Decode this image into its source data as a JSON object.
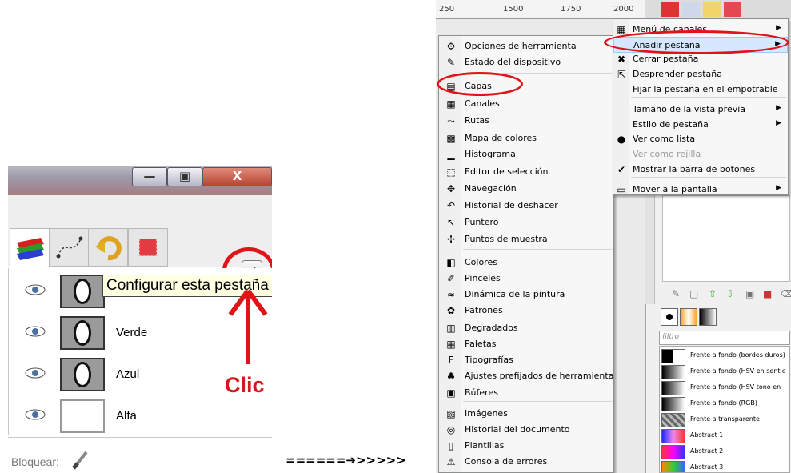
{
  "left_panel": {
    "window_buttons": {
      "minimize": "—",
      "maximize": "▣",
      "close": "X"
    },
    "tab_config_tooltip": "Configurar esta pestaña",
    "channels": [
      {
        "name": ""
      },
      {
        "name": "Verde"
      },
      {
        "name": "Azul"
      },
      {
        "name": "Alfa"
      }
    ],
    "click_label": "Clic",
    "lock_label": "Bloquear:"
  },
  "between_arrow": "======➔>>>>>",
  "ruler": {
    "labels": [
      "250",
      "1500",
      "1750",
      "2000"
    ]
  },
  "tab_menu": {
    "items": [
      {
        "label": "Opciones de herramienta",
        "icon": "tool-options-icon",
        "glyph": "⚙"
      },
      {
        "label": "Estado del dispositivo",
        "icon": "device-status-icon",
        "glyph": "✎"
      },
      {
        "label": "Capas",
        "icon": "layers-icon",
        "glyph": "▤"
      },
      {
        "label": "Canales",
        "icon": "channels-icon",
        "glyph": "▦"
      },
      {
        "label": "Rutas",
        "icon": "paths-icon",
        "glyph": "⤳"
      },
      {
        "label": "Mapa de colores",
        "icon": "colormap-icon",
        "glyph": "▩"
      },
      {
        "label": "Histograma",
        "icon": "histogram-icon",
        "glyph": "▁"
      },
      {
        "label": "Editor de selección",
        "icon": "selection-editor-icon",
        "glyph": "⬚"
      },
      {
        "label": "Navegación",
        "icon": "navigation-icon",
        "glyph": "✥"
      },
      {
        "label": "Historial de deshacer",
        "icon": "undo-history-icon",
        "glyph": "↶"
      },
      {
        "label": "Puntero",
        "icon": "pointer-icon",
        "glyph": "↖"
      },
      {
        "label": "Puntos de muestra",
        "icon": "sample-points-icon",
        "glyph": "✢"
      },
      {
        "label": "Colores",
        "icon": "colors-icon",
        "glyph": "◧"
      },
      {
        "label": "Pinceles",
        "icon": "brushes-icon",
        "glyph": "✐"
      },
      {
        "label": "Dinámica de la pintura",
        "icon": "paint-dynamics-icon",
        "glyph": "≈"
      },
      {
        "label": "Patrones",
        "icon": "patterns-icon",
        "glyph": "✿"
      },
      {
        "label": "Degradados",
        "icon": "gradients-icon",
        "glyph": "▥"
      },
      {
        "label": "Paletas",
        "icon": "palettes-icon",
        "glyph": "▦"
      },
      {
        "label": "Tipografías",
        "icon": "fonts-icon",
        "glyph": "F"
      },
      {
        "label": "Ajustes prefijados de herramienta",
        "icon": "tool-presets-icon",
        "glyph": "♣"
      },
      {
        "label": "Búferes",
        "icon": "buffers-icon",
        "glyph": "▣"
      },
      {
        "label": "Imágenes",
        "icon": "images-icon",
        "glyph": "▧"
      },
      {
        "label": "Historial del documento",
        "icon": "document-history-icon",
        "glyph": "◎"
      },
      {
        "label": "Plantillas",
        "icon": "templates-icon",
        "glyph": "▯"
      },
      {
        "label": "Consola de errores",
        "icon": "error-console-icon",
        "glyph": "⚠"
      }
    ]
  },
  "config_menu": {
    "items": [
      {
        "label": "Menú de canales",
        "icon": "channels-menu-icon",
        "glyph": "▦",
        "submenu": true
      },
      {
        "label": "Añadir pestaña",
        "icon": "",
        "glyph": "",
        "submenu": true,
        "highlighted": true
      },
      {
        "label": "Cerrar pestaña",
        "icon": "close-tab-icon",
        "glyph": "✖",
        "submenu": false
      },
      {
        "label": "Desprender pestaña",
        "icon": "detach-tab-icon",
        "glyph": "⇱",
        "submenu": false
      },
      {
        "label": "Fijar la pestaña en el empotrable",
        "icon": "",
        "glyph": "",
        "submenu": false
      },
      {
        "label": "Tamaño de la vista previa",
        "icon": "",
        "glyph": "",
        "submenu": true
      },
      {
        "label": "Estilo de pestaña",
        "icon": "",
        "glyph": "",
        "submenu": true
      },
      {
        "label": "Ver como lista",
        "icon": "radio-bullet-icon",
        "glyph": "●",
        "submenu": false
      },
      {
        "label": "Ver como rejilla",
        "icon": "",
        "glyph": "",
        "submenu": false,
        "disabled": true
      },
      {
        "label": "Mostrar la barra de botones",
        "icon": "checkmark-icon",
        "glyph": "✔",
        "submenu": false
      },
      {
        "label": "Mover a la pantalla",
        "icon": "move-screen-icon",
        "glyph": "▭",
        "submenu": true
      }
    ]
  },
  "gradients": {
    "filter_placeholder": "filtro",
    "items": [
      {
        "label": "Frente a fondo (bordes duros)"
      },
      {
        "label": "Frente a fondo (HSV en sentic"
      },
      {
        "label": "Frente a fondo (HSV tono en"
      },
      {
        "label": "Frente a fondo (RGB)"
      },
      {
        "label": "Frente a transparente"
      },
      {
        "label": "Abstract 1"
      },
      {
        "label": "Abstract 2"
      },
      {
        "label": "Abstract 3"
      }
    ]
  },
  "colors": {
    "annotation_red": "#e01418",
    "highlight": "#d6e8ff"
  }
}
